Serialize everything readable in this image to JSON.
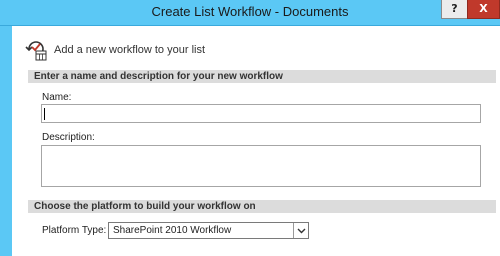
{
  "window": {
    "title": "Create List Workflow - Documents",
    "help_label": "?",
    "close_label": "X"
  },
  "header": {
    "text": "Add a new workflow to your list"
  },
  "section_name_desc": {
    "title": "Enter a name and description for your new workflow",
    "name_label": "Name:",
    "name_value": "",
    "description_label": "Description:",
    "description_value": ""
  },
  "section_platform": {
    "title": "Choose the platform to build your workflow on",
    "platform_label": "Platform Type:",
    "platform_value": "SharePoint 2010 Workflow"
  },
  "colors": {
    "titlebar": "#5bc8f5",
    "section_bar": "#dcdcdc",
    "close": "#c0392b"
  },
  "icons": {
    "header": "workflow-icon",
    "dropdown": "chevron-down-icon"
  }
}
